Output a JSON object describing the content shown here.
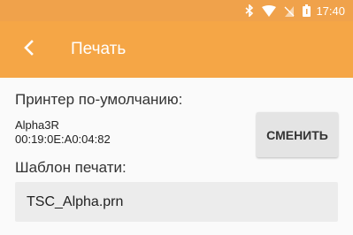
{
  "status_bar": {
    "time": "17:40",
    "icons": [
      "bluetooth-icon",
      "wifi-icon",
      "no-sim-icon",
      "battery-icon"
    ]
  },
  "app_bar": {
    "title": "Печать",
    "back_icon": "back-arrow-icon",
    "color": "#f5a646"
  },
  "printer": {
    "label": "Принтер по-умолчанию:",
    "name": "Alpha3R",
    "mac": "00:19:0E:A0:04:82",
    "change_button": "СМЕНИТЬ"
  },
  "template": {
    "label": "Шаблон печати:",
    "value": "TSC_Alpha.prn"
  }
}
